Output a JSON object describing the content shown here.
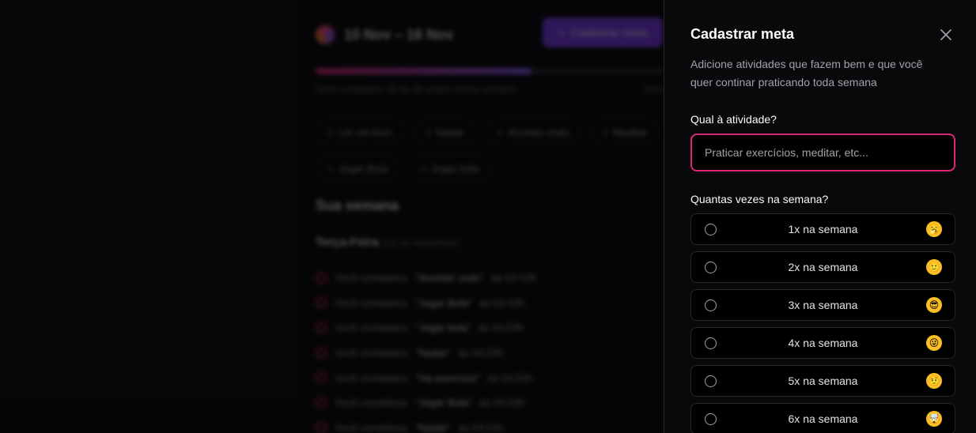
{
  "background": {
    "week_range": "10 Nov – 16 Nov",
    "create_button_label": "Cadastrar meta",
    "progress": {
      "fraction": 0.62,
      "text_left": "Você completou 18 de 29 metas nessa semana.",
      "text_right": "62%"
    },
    "pending_goals": [
      "Ler um livro",
      "Nadar",
      "Acordar cedo",
      "Meditar",
      "Jogar Bola",
      "Jogar bola"
    ],
    "section_title": "Sua semana",
    "day": {
      "name": "Terça-Feira",
      "date": "(12 de novembro)"
    },
    "completed": [
      {
        "prefix": "Você completou",
        "goal": "“Acordar cedo”",
        "suffix": "às 04:53h"
      },
      {
        "prefix": "Você completou",
        "goal": "“Jogar Bola”",
        "suffix": "às 04:53h"
      },
      {
        "prefix": "Você completou",
        "goal": "“Jogar bola”",
        "suffix": "às 04:53h"
      },
      {
        "prefix": "Você completou",
        "goal": "“Nadar”",
        "suffix": "às 04:53h"
      },
      {
        "prefix": "Você completou",
        "goal": "“Ha exercício”",
        "suffix": "às 04:53h"
      },
      {
        "prefix": "Você completou",
        "goal": "“Jogar Bola”",
        "suffix": "às 04:53h"
      },
      {
        "prefix": "Você completou",
        "goal": "“Nadar”",
        "suffix": "às 04:53h"
      }
    ]
  },
  "panel": {
    "title": "Cadastrar meta",
    "description": "Adicione atividades que fazem bem e que você quer continar praticando toda semana",
    "activity_label": "Qual à atividade?",
    "activity_placeholder": "Praticar exercícios, meditar, etc...",
    "activity_value": "",
    "frequency_label": "Quantas vezes na semana?",
    "options": [
      {
        "label": "1x na semana",
        "emoji": "🥱"
      },
      {
        "label": "2x na semana",
        "emoji": "🙂"
      },
      {
        "label": "3x na semana",
        "emoji": "😎"
      },
      {
        "label": "4x na semana",
        "emoji": "😜"
      },
      {
        "label": "5x na semana",
        "emoji": "🤨"
      },
      {
        "label": "6x na semana",
        "emoji": "🤯"
      }
    ]
  },
  "colors": {
    "accent": "#db2777",
    "violet": "#7c3aed",
    "panel_bg": "#09090b",
    "border": "#27272a"
  }
}
